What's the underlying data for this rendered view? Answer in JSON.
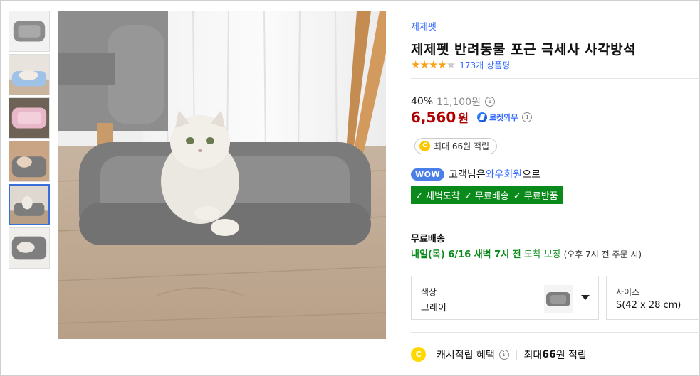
{
  "product": {
    "brand": "제제펫",
    "title": "제제펫 반려동물 포근 극세사 사각방석",
    "rating_stars": 4,
    "review_count": "173개 상품평",
    "discount_rate": "40%",
    "original_price": "11,100원",
    "price": "6,560",
    "currency": "원",
    "rocket_label": "로켓와우",
    "cash_pill": "최대 66원 적립",
    "coin_letter": "C"
  },
  "wow": {
    "badge": "WOW",
    "prefix": "고객님은 ",
    "member": "와우회원",
    "suffix": "으로",
    "benefits": [
      "✓ 새벽도착",
      "✓ 무료배송",
      "✓ 무료반품"
    ]
  },
  "shipping": {
    "label": "무료배송",
    "date_main": "내일(목) 6/16 새벽 7시 전",
    "date_guarantee": " 도착 보장",
    "date_note": " (오후 7시 전 주문 시)"
  },
  "options": {
    "color_label": "색상",
    "color_value": "그레이",
    "size_label": "사이즈",
    "size_value": "S(42 x 28 cm)"
  },
  "cash_benefit": {
    "label": "캐시적립 혜택",
    "prefix": "최대 ",
    "amount": "66",
    "suffix": "원 적립"
  },
  "info_glyph": "i",
  "colors": {
    "accent_blue": "#346aff",
    "price_red": "#ae0000",
    "benefit_green": "#0a8a1a",
    "star": "#f8a21a",
    "selected_thumb_border": "#3a6fd8"
  }
}
